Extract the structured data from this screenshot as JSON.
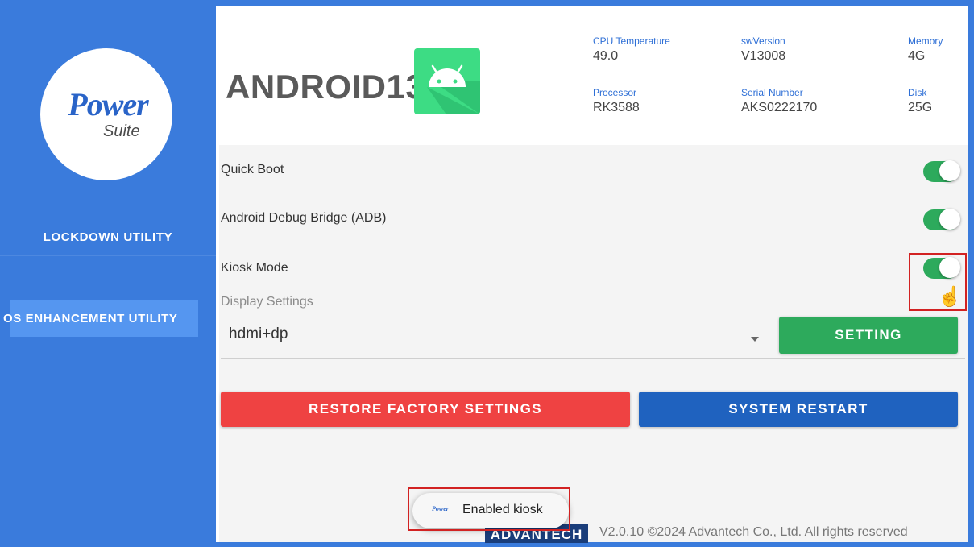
{
  "sidebar": {
    "logo": {
      "power": "Power",
      "suite": "Suite"
    },
    "items": [
      {
        "label": "LOCKDOWN UTILITY"
      },
      {
        "label": "OS ENHANCEMENT UTILITY"
      }
    ]
  },
  "header": {
    "device_name": "ANDROID13",
    "info": [
      {
        "label": "CPU Temperature",
        "value": "49.0"
      },
      {
        "label": "swVersion",
        "value": "V13008"
      },
      {
        "label": "Memory",
        "value": "4G"
      },
      {
        "label": "Processor",
        "value": "RK3588"
      },
      {
        "label": "Serial Number",
        "value": "AKS0222170"
      },
      {
        "label": "Disk",
        "value": "25G"
      }
    ]
  },
  "settings": {
    "quick_boot": {
      "label": "Quick Boot",
      "enabled": true
    },
    "adb": {
      "label": "Android Debug Bridge (ADB)",
      "enabled": true
    },
    "kiosk": {
      "label": "Kiosk Mode",
      "enabled": true
    },
    "display": {
      "label": "Display Settings",
      "value": "hdmi+dp",
      "button": "SETTING"
    }
  },
  "actions": {
    "restore": "RESTORE FACTORY SETTINGS",
    "restart": "SYSTEM RESTART"
  },
  "footer": {
    "brand": "ADVANTECH",
    "copyright": "V2.0.10 ©2024 Advantech Co., Ltd.  All rights reserved"
  },
  "toast": {
    "message": "Enabled kiosk",
    "icon_text": "Power"
  },
  "colors": {
    "sidebar": "#3a7bdc",
    "toggle_on": "#2daa5c",
    "restore": "#ef4242",
    "restart": "#1f62bf",
    "highlight": "#d22222"
  }
}
